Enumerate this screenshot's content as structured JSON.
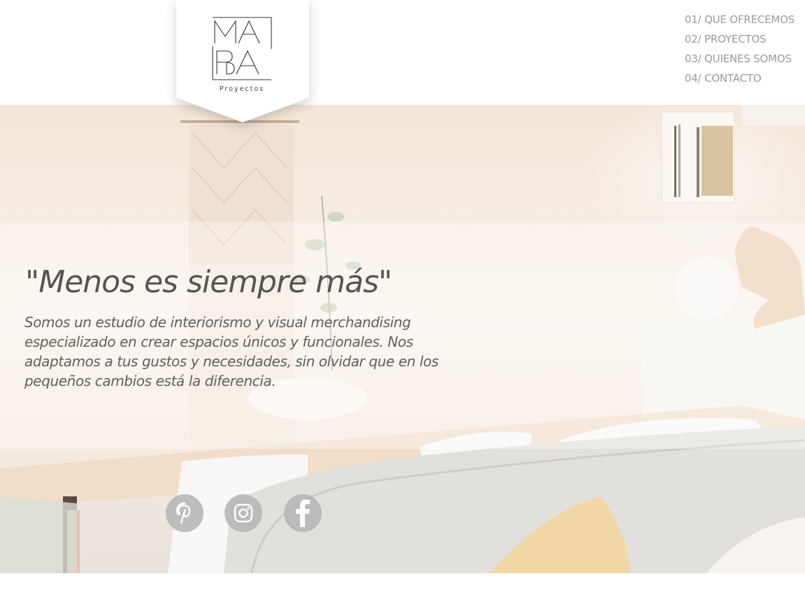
{
  "logo": {
    "line1": "MA",
    "line2": "BA",
    "subtitle": "Proyectos"
  },
  "nav": {
    "items": [
      {
        "label": "01/ QUE OFRECEMOS"
      },
      {
        "label": "02/ PROYECTOS"
      },
      {
        "label": "03/ QUIENES SOMOS"
      },
      {
        "label": "04/ CONTACTO"
      }
    ]
  },
  "hero": {
    "quote": "\"Menos es siempre más\"",
    "lead": "Somos un estudio de interiorismo y visual merchandising especializado en crear espacios únicos y funcionales. Nos adaptamos a tus gustos y necesidades, sin olvidar que en los pequeños cambios está la diferencia."
  },
  "social": {
    "icons": [
      "pinterest-icon",
      "instagram-icon",
      "facebook-icon"
    ]
  },
  "colors": {
    "nav_text": "#9a9a9a",
    "headline": "#555555",
    "icon_circle": "#b4b4b4"
  }
}
